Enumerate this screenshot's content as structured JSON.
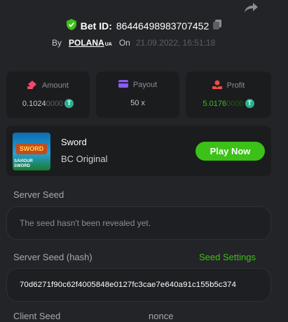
{
  "header": {
    "bet_label": "Bet ID:",
    "bet_id": "86446498983707452",
    "by_label": "By",
    "username": "POLANA",
    "username_suffix": "UA",
    "on_label": "On",
    "date": "21.09.2022, 16:51:18"
  },
  "stats": [
    {
      "label": "Amount",
      "value_main": "0.1024",
      "value_dim": "0000",
      "token": "T"
    },
    {
      "label": "Payout",
      "value_main": "50 x"
    },
    {
      "label": "Profit",
      "value_main": "5.0176",
      "value_dim": "0000",
      "token": "T"
    }
  ],
  "game": {
    "thumb_title": "SWORD",
    "thumb_sub": "SAVIOUR SWORD",
    "name": "Sword",
    "provider": "BC Original",
    "play_label": "Play Now"
  },
  "seeds": {
    "server_seed_label": "Server Seed",
    "server_seed_value": "The seed hasn't been revealed yet.",
    "server_hash_label": "Server Seed (hash)",
    "seed_settings_label": "Seed Settings",
    "server_hash_value": "70d6271f90c62f4005848e0127fc3cae7e640a91c155b5c374",
    "client_seed_label": "Client Seed",
    "nonce_label": "nonce"
  },
  "colors": {
    "accent": "#3bc117",
    "background": "#232427",
    "card": "#1b1c1e",
    "profit": "#3bc117",
    "token": "#2bb08e"
  },
  "icons": [
    "share-icon",
    "verified-shield-icon",
    "copy-icon",
    "amount-icon",
    "payout-icon",
    "profit-icon",
    "tether-icon"
  ]
}
